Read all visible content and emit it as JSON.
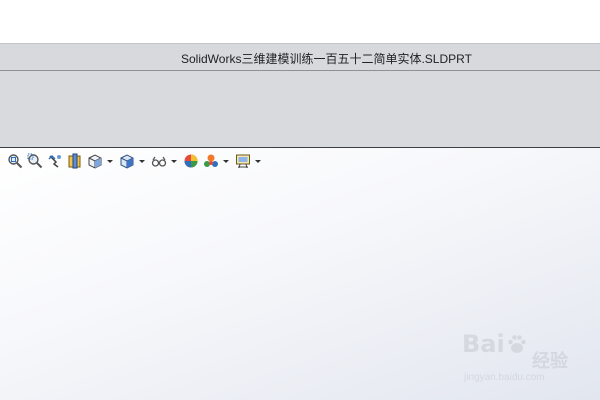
{
  "window": {
    "title": "SolidWorks三维建模训练一百五十二简单实体.SLDPRT"
  },
  "hud_toolbar": {
    "tools": [
      {
        "icon": "zoom-to-fit-icon"
      },
      {
        "icon": "zoom-to-area-icon"
      },
      {
        "icon": "previous-view-icon"
      },
      {
        "icon": "section-view-icon"
      },
      {
        "icon": "view-orientation-icon",
        "dropdown": true
      },
      {
        "icon": "display-style-icon",
        "dropdown": true
      },
      {
        "icon": "hide-show-items-icon",
        "dropdown": true
      },
      {
        "icon": "edit-appearance-icon"
      },
      {
        "icon": "apply-scene-icon",
        "dropdown": true
      },
      {
        "icon": "view-settings-icon",
        "dropdown": true
      }
    ]
  },
  "watermark": {
    "logo_left": "Bai",
    "logo_right": "",
    "label": "经验",
    "url": "jingyan.baidu.com"
  },
  "colors": {
    "title_bar": "#d7d9dd",
    "ribbon": "#d8dade",
    "viewport_top": "#ffffff",
    "viewport_bottom": "#e2e6ef"
  }
}
